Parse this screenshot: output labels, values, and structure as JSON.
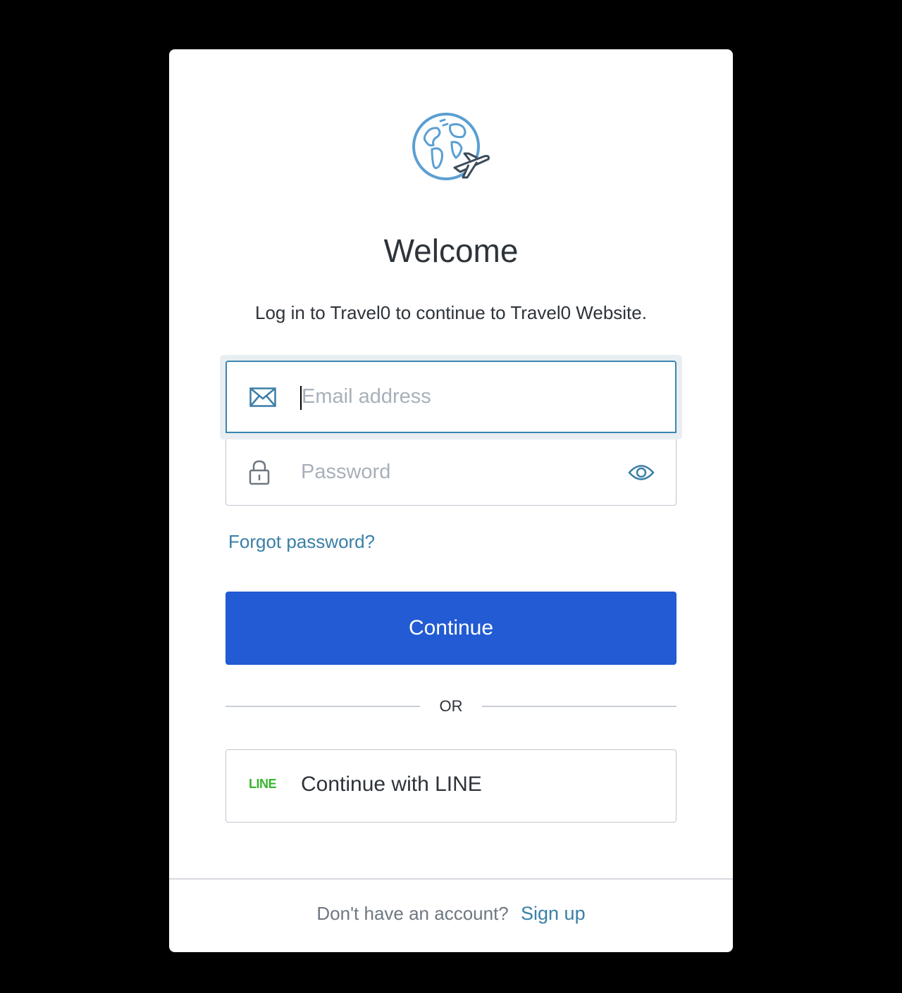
{
  "header": {
    "title": "Welcome",
    "subtitle": "Log in to Travel0 to continue to Travel0 Website."
  },
  "form": {
    "email_placeholder": "Email address",
    "password_placeholder": "Password",
    "forgot_password": "Forgot password?",
    "continue_label": "Continue",
    "divider_text": "OR"
  },
  "social": {
    "line_logo_text": "LINE",
    "line_label": "Continue with LINE"
  },
  "footer": {
    "prompt": "Don't have an account?",
    "signup_link": "Sign up"
  },
  "icons": {
    "logo": "globe-airplane-logo",
    "email": "envelope-icon",
    "password": "lock-icon",
    "show_password": "eye-icon"
  },
  "colors": {
    "accent": "#225bd3",
    "link": "#3a7fa6",
    "line_green": "#37b42e",
    "focus_border": "#3a86b2"
  }
}
